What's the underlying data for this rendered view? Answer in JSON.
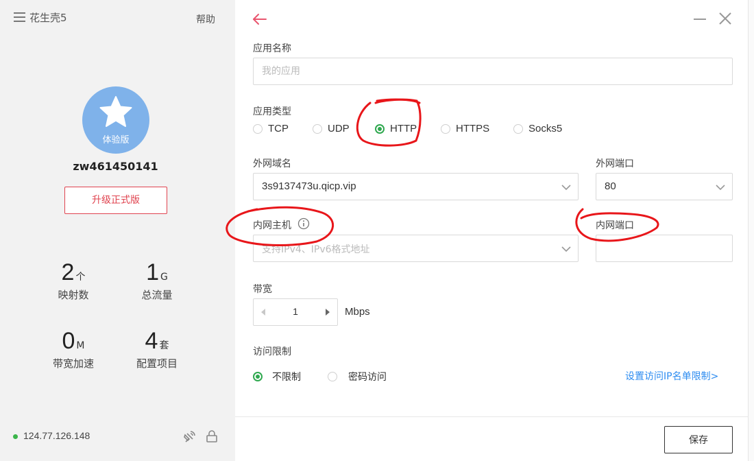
{
  "sidebar": {
    "app_title": "花生壳5",
    "help": "帮助",
    "avatar_badge": "体验版",
    "username": "zw461450141",
    "upgrade_label": "升级正式版",
    "stats": [
      {
        "value": "2",
        "unit": "个",
        "label": "映射数"
      },
      {
        "value": "1",
        "unit": "G",
        "label": "总流量"
      },
      {
        "value": "0",
        "unit": "M",
        "label": "带宽加速"
      },
      {
        "value": "4",
        "unit": "套",
        "label": "配置项目"
      }
    ],
    "ip": "124.77.126.148",
    "status_color": "#3bb54a"
  },
  "form": {
    "app_name_label": "应用名称",
    "app_name_placeholder": "我的应用",
    "app_type_label": "应用类型",
    "app_types": [
      "TCP",
      "UDP",
      "HTTP",
      "HTTPS",
      "Socks5"
    ],
    "app_type_selected": "HTTP",
    "domain_label": "外网域名",
    "domain_value": "3s9137473u.qicp.vip",
    "ext_port_label": "外网端口",
    "ext_port_value": "80",
    "int_host_label": "内网主机",
    "int_host_placeholder": "支持IPv4、IPv6格式地址",
    "int_port_label": "内网端口",
    "int_port_value": "",
    "bandwidth_label": "带宽",
    "bandwidth_value": "1",
    "bandwidth_unit": "Mbps",
    "access_label": "访问限制",
    "access_options": [
      "不限制",
      "密码访问"
    ],
    "access_selected": "不限制",
    "ip_limit_link": "设置访问IP名单限制>",
    "save_label": "保存"
  },
  "colors": {
    "accent_green": "#2fa84f",
    "link_blue": "#2d8cf0",
    "upgrade_red": "#e0434f",
    "back_arrow": "#e9556e",
    "annotation_red": "#e8161a"
  },
  "icons": [
    "menu-icon",
    "star-icon",
    "back-arrow-icon",
    "minimize-icon",
    "close-icon",
    "chevron-down-icon",
    "info-icon",
    "caret-left-icon",
    "caret-right-icon",
    "satellite-icon",
    "lock-icon"
  ]
}
